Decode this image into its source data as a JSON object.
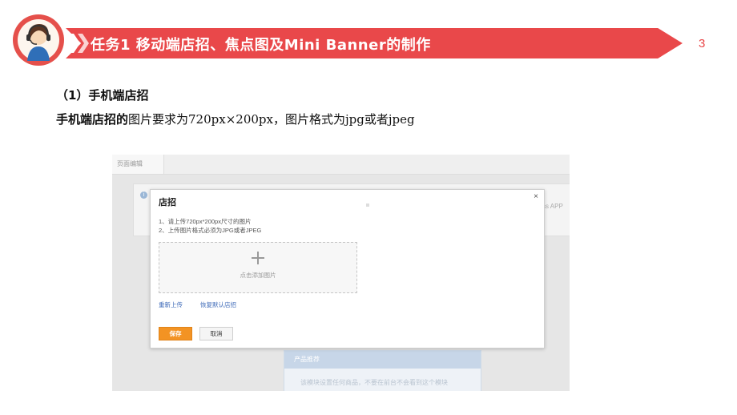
{
  "slide": {
    "title": "任务1    移动端店招、焦点图及Mini Banner的制作",
    "page_number": "3",
    "section_heading": "（1）手机端店招",
    "body_bold": "手机端店招的",
    "body_rest": "图片要求为720px×200px，图片格式为jpg或者jpeg"
  },
  "colors": {
    "accent": "#e9484a",
    "save_button": "#f39323",
    "link": "#3f6bb8"
  },
  "screenshot": {
    "tab_label": "页面编辑",
    "info_icon": "info-icon",
    "edge_text": "ss APP",
    "modal": {
      "title": "店招",
      "close_glyph": "×",
      "note_1": "1、请上传720px*200px尺寸的图片",
      "note_2": "2、上传图片格式必须为JPG或者JPEG",
      "upload_placeholder": "点击添加图片",
      "reupload_link": "重新上传",
      "restore_link": "恢复默认店招",
      "save_label": "保存",
      "cancel_label": "取消"
    },
    "product_panel": {
      "title": "产品推荐",
      "body": "该模块设置任何商品，不要在前台不会看到这个模块"
    }
  }
}
